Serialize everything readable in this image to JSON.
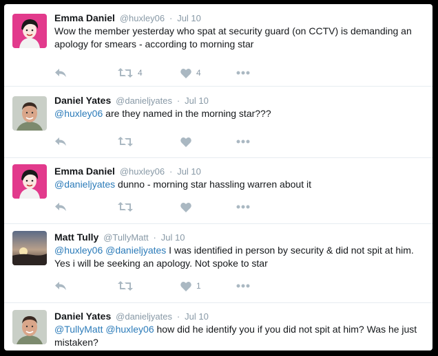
{
  "tweets": [
    {
      "name": "Emma Daniel",
      "handle": "@huxley06",
      "date": "Jul 10",
      "avatar": "woman-cartoon-avatar",
      "mention": "",
      "body": "Wow the member yesterday who spat at security guard (on CCTV) is demanding an apology for smears - according to morning star",
      "retweets": "4",
      "likes": "4"
    },
    {
      "name": "Daniel Yates",
      "handle": "@danieljyates",
      "date": "Jul 10",
      "avatar": "man-photo-avatar",
      "mention": "@huxley06",
      "body": " are they named in the morning star???",
      "retweets": "",
      "likes": ""
    },
    {
      "name": "Emma Daniel",
      "handle": "@huxley06",
      "date": "Jul 10",
      "avatar": "woman-cartoon-avatar",
      "mention": "@danieljyates",
      "body": " dunno - morning star hassling warren about it",
      "retweets": "",
      "likes": ""
    },
    {
      "name": "Matt Tully",
      "handle": "@TullyMatt",
      "date": "Jul 10",
      "avatar": "sunset-photo-avatar",
      "mention": "@huxley06 @danieljyates",
      "body": " I was identified in person by security & did not spit at him. Yes i will be seeking an apology. Not spoke to star",
      "retweets": "",
      "likes": "1"
    },
    {
      "name": "Daniel Yates",
      "handle": "@danieljyates",
      "date": "Jul 10",
      "avatar": "man-photo-avatar",
      "mention": "@TullyMatt @huxley06",
      "body": " how did he identify you if you did not spit at him? Was he just mistaken?",
      "retweets": "",
      "likes": ""
    }
  ],
  "separator": "·",
  "icons": {
    "reply": "reply-icon",
    "retweet": "retweet-icon",
    "like": "heart-icon",
    "more": "more-icon"
  },
  "colors": {
    "text": "#14171a",
    "muted": "#8899a6",
    "link": "#2b7bb9",
    "icon": "#aab8c2",
    "border": "#e6ecf0"
  }
}
